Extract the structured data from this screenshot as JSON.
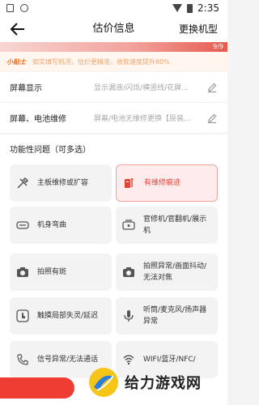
{
  "status": {
    "time": "2:35"
  },
  "header": {
    "title": "估价信息",
    "switch_model": "更换机型"
  },
  "progress": {
    "text": "9/9"
  },
  "tip": {
    "tag": "小贴士",
    "text": "如实填写机况，估价更精准，收款速度提升80%"
  },
  "rows": [
    {
      "label": "屏幕显示",
      "value": "显示漏液/闪烁/横竖线/花屏…"
    },
    {
      "label": "屏幕、电池维修",
      "value": "屏幕/电池无维修更换【原装…"
    }
  ],
  "functional": {
    "title": "功能性问题（可多选）",
    "options": [
      {
        "label": "主板维修或扩容",
        "icon": "tools-icon",
        "selected": false
      },
      {
        "label": "有维修痕迹",
        "icon": "repair-trace-icon",
        "selected": true
      },
      {
        "label": "机身弯曲",
        "icon": "phone-bend-icon",
        "selected": false
      },
      {
        "label": "官修机/官翻机/展示机",
        "icon": "phone-refurb-icon",
        "selected": false
      },
      {
        "label": "拍照有斑",
        "icon": "camera-icon",
        "selected": false
      },
      {
        "label": "拍照异常/画面抖动/无法对焦",
        "icon": "camera-icon",
        "selected": false
      },
      {
        "label": "触摸局部失灵/延迟",
        "icon": "touch-icon",
        "selected": false
      },
      {
        "label": "听筒/麦克风/扬声器异常",
        "icon": "microphone-icon",
        "selected": false
      },
      {
        "label": "信号异常/无法通话",
        "icon": "phone-call-icon",
        "selected": false
      },
      {
        "label": "WIFI/蓝牙/NFC/",
        "icon": "wifi-icon",
        "selected": false
      }
    ]
  },
  "watermark": {
    "text": "给力游戏网"
  },
  "colors": {
    "accent": "#ef3d33",
    "tip_tag": "#f06c1a",
    "selected_bg": "#fdeceb"
  }
}
